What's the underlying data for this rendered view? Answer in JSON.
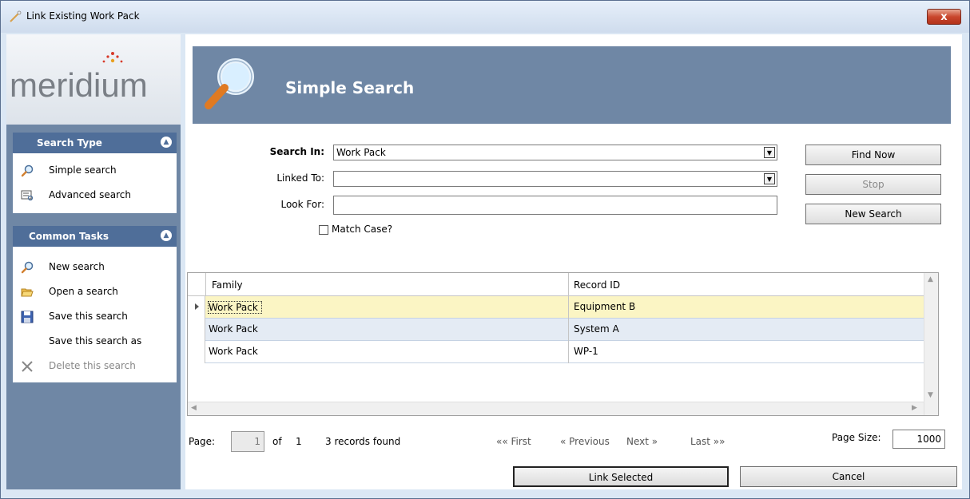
{
  "window": {
    "title": "Link Existing Work Pack",
    "close_label": "x"
  },
  "logo": {
    "text": "meridium"
  },
  "search_type": {
    "header": "Search Type",
    "items": [
      {
        "label": "Simple search",
        "icon": "magnifier-icon"
      },
      {
        "label": "Advanced search",
        "icon": "advanced-search-icon"
      }
    ]
  },
  "common_tasks": {
    "header": "Common Tasks",
    "items": [
      {
        "label": "New search",
        "icon": "magnifier-icon"
      },
      {
        "label": "Open a search",
        "icon": "folder-open-icon"
      },
      {
        "label": "Save this search",
        "icon": "floppy-disk-icon"
      },
      {
        "label": "Save this search as",
        "icon": ""
      },
      {
        "label": "Delete this search",
        "icon": "delete-x-icon",
        "disabled": true
      }
    ]
  },
  "banner": {
    "title": "Simple Search"
  },
  "form": {
    "search_in_label": "Search In:",
    "search_in_value": "Work Pack",
    "linked_to_label": "Linked To:",
    "linked_to_value": "",
    "look_for_label": "Look For:",
    "look_for_value": "",
    "match_case_label": "Match Case?"
  },
  "buttons": {
    "find_now": "Find Now",
    "stop": "Stop",
    "new_search": "New Search"
  },
  "grid": {
    "columns": [
      "Family",
      "Record ID"
    ],
    "rows": [
      {
        "family": "Work Pack",
        "record_id": "Equipment B"
      },
      {
        "family": "Work Pack",
        "record_id": "System A"
      },
      {
        "family": "Work Pack",
        "record_id": "WP-1"
      }
    ]
  },
  "pager": {
    "page_label": "Page:",
    "page_value": "1",
    "of_label": "of",
    "total_pages": "1",
    "records_found": "3 records found",
    "first": "«« First",
    "previous": "« Previous",
    "next": "Next »",
    "last": "Last »»",
    "page_size_label": "Page Size:",
    "page_size_value": "1000"
  },
  "footer": {
    "link_selected": "Link Selected",
    "cancel": "Cancel"
  },
  "colors": {
    "accent": "#6f87a5",
    "panel_header": "#4f6e99",
    "selected_row": "#fbf5c4",
    "alt_row": "#e4ebf4"
  }
}
